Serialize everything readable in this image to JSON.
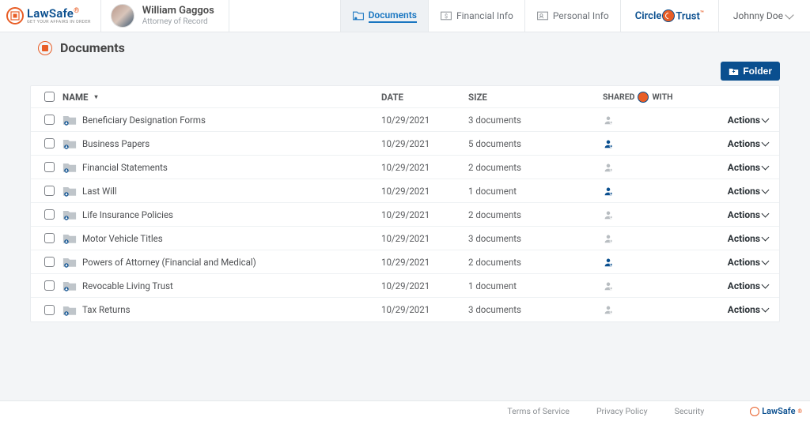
{
  "brand": {
    "name": "LawSafe",
    "tagline": "GET YOUR AFFAIRS IN ORDER"
  },
  "attorney": {
    "name": "William Gaggos",
    "role": "Attorney of Record"
  },
  "nav": {
    "documents": "Documents",
    "financial": "Financial Info",
    "personal": "Personal Info",
    "circle": "Circle",
    "trust": "Trust"
  },
  "user": {
    "name": "Johnny Doe"
  },
  "page": {
    "title": "Documents",
    "folder_btn": "Folder"
  },
  "table": {
    "headers": {
      "name": "NAME",
      "date": "DATE",
      "size": "SIZE",
      "shared_pre": "SHARED",
      "shared_post": "WITH",
      "actions": "Actions"
    },
    "rows": [
      {
        "name": "Beneficiary Designation Forms",
        "date": "10/29/2021",
        "size": "3 documents",
        "shared": false
      },
      {
        "name": "Business Papers",
        "date": "10/29/2021",
        "size": "5 documents",
        "shared": true
      },
      {
        "name": "Financial Statements",
        "date": "10/29/2021",
        "size": "2 documents",
        "shared": false
      },
      {
        "name": "Last Will",
        "date": "10/29/2021",
        "size": "1 document",
        "shared": true
      },
      {
        "name": "Life Insurance Policies",
        "date": "10/29/2021",
        "size": "2 documents",
        "shared": false
      },
      {
        "name": "Motor Vehicle Titles",
        "date": "10/29/2021",
        "size": "3 documents",
        "shared": false
      },
      {
        "name": "Powers of Attorney (Financial and Medical)",
        "date": "10/29/2021",
        "size": "2 documents",
        "shared": true
      },
      {
        "name": "Revocable Living Trust",
        "date": "10/29/2021",
        "size": "1 document",
        "shared": false
      },
      {
        "name": "Tax Returns",
        "date": "10/29/2021",
        "size": "3 documents",
        "shared": false
      }
    ]
  },
  "footer": {
    "terms": "Terms of Service",
    "privacy": "Privacy Policy",
    "security": "Security"
  }
}
